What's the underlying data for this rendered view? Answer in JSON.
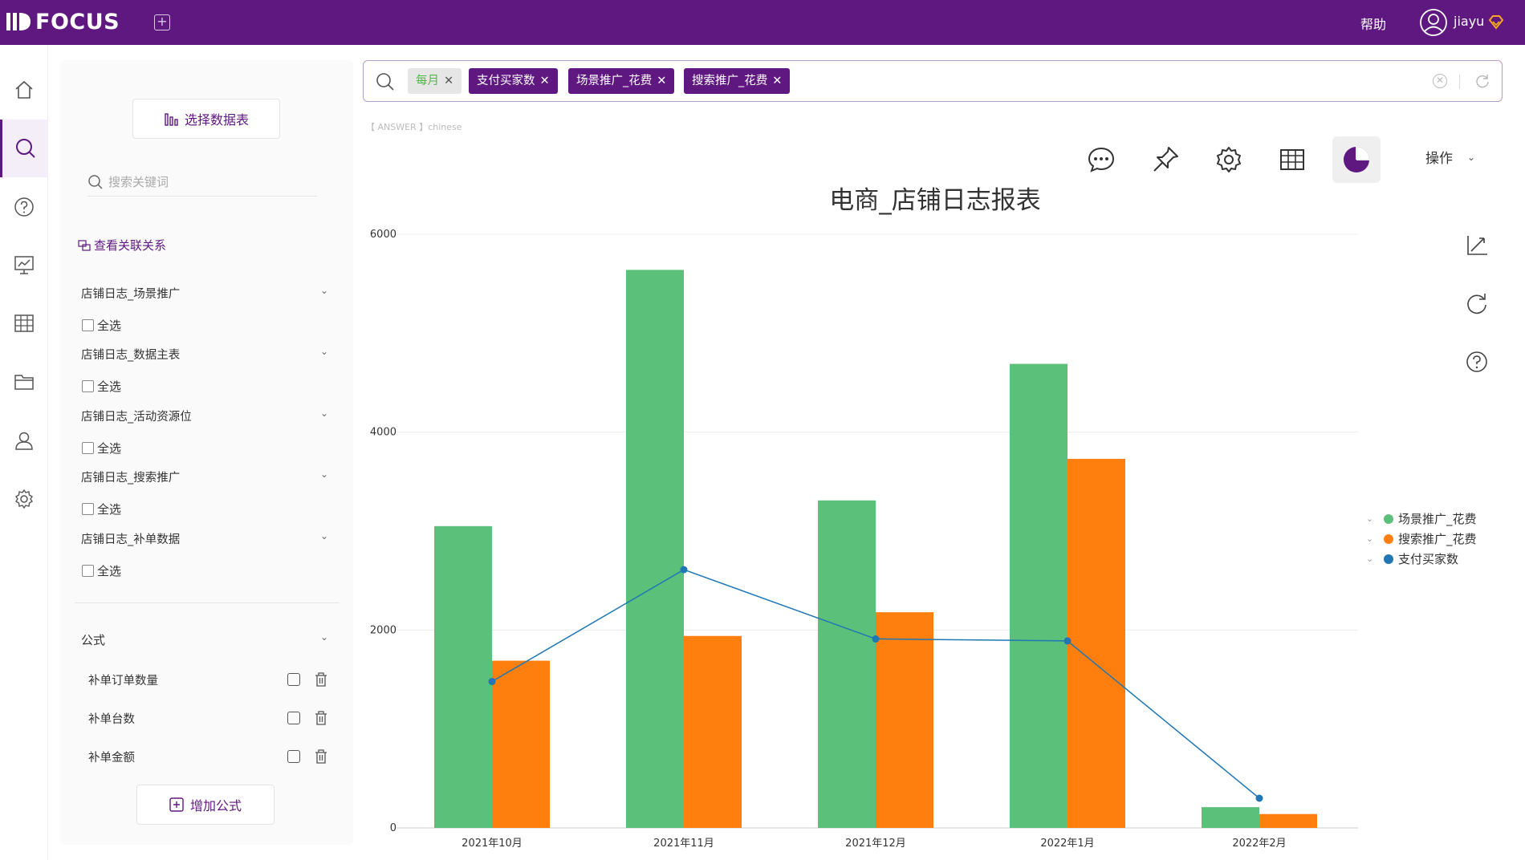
{
  "app": {
    "name": "FOCUS",
    "help": "帮助",
    "user": "jiayu"
  },
  "sidebar": {
    "select_table": "选择数据表",
    "search_placeholder": "搜索关键词",
    "relation_link": "查看关联关系",
    "groups": [
      {
        "name": "店铺日志_场景推广",
        "select_all": "全选"
      },
      {
        "name": "店铺日志_数据主表",
        "select_all": "全选"
      },
      {
        "name": "店铺日志_活动资源位",
        "select_all": "全选"
      },
      {
        "name": "店铺日志_搜索推广",
        "select_all": "全选"
      },
      {
        "name": "店铺日志_补单数据",
        "select_all": "全选"
      }
    ],
    "formula_header": "公式",
    "formulas": [
      "补单订单数量",
      "补单台数",
      "补单金额"
    ],
    "add_formula": "增加公式"
  },
  "search": {
    "tokens": [
      "每月",
      "支付买家数",
      "场景推广_花费",
      "搜索推广_花费"
    ]
  },
  "answer_tag": "【 ANSWER 】chinese",
  "toolbar": {
    "ops_label": "操作",
    "icons": [
      "comment-icon",
      "pin-icon",
      "settings-icon",
      "table-icon",
      "pie-chart-icon"
    ]
  },
  "colors": {
    "brand": "#5e1880",
    "green": "#5bc07a",
    "orange": "#ff7f0e",
    "blue": "#1f77b4"
  },
  "chart_data": {
    "type": "bar",
    "title": "电商_店铺日志报表",
    "categories": [
      "2021年10月",
      "2021年11月",
      "2021年12月",
      "2022年1月",
      "2022年2月"
    ],
    "series": [
      {
        "name": "场景推广_花费",
        "type": "bar",
        "color": "#5bc07a",
        "values": [
          3050,
          5640,
          3310,
          4690,
          210
        ]
      },
      {
        "name": "搜索推广_花费",
        "type": "bar",
        "color": "#ff7f0e",
        "values": [
          1690,
          1940,
          2180,
          3730,
          140
        ]
      },
      {
        "name": "支付买家数",
        "type": "line",
        "color": "#1f77b4",
        "values": [
          1480,
          2610,
          1910,
          1890,
          300
        ]
      }
    ],
    "yticks": [
      "0",
      "2000",
      "4000",
      "6000"
    ],
    "ylim": [
      0,
      6000
    ],
    "grid": true,
    "legend_position": "right"
  }
}
